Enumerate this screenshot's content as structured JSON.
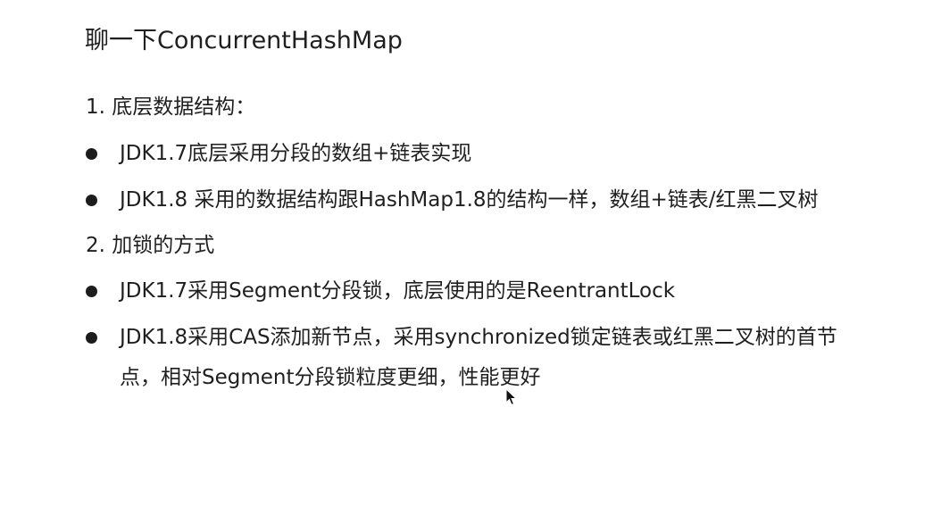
{
  "title": "聊一下ConcurrentHashMap",
  "sections": [
    {
      "heading": "1. 底层数据结构：",
      "bullets": [
        "JDK1.7底层采用分段的数组+链表实现",
        "JDK1.8 采用的数据结构跟HashMap1.8的结构一样，数组+链表/红黑二叉树"
      ]
    },
    {
      "heading": "2. 加锁的方式",
      "bullets": [
        "JDK1.7采用Segment分段锁，底层使用的是ReentrantLock",
        "JDK1.8采用CAS添加新节点，采用synchronized锁定链表或红黑二叉树的首节"
      ],
      "continuation": "点，相对Segment分段锁粒度更细，性能更好"
    }
  ],
  "icons": {
    "bullet": "filled-circle-icon",
    "cursor": "mouse-pointer-icon"
  }
}
